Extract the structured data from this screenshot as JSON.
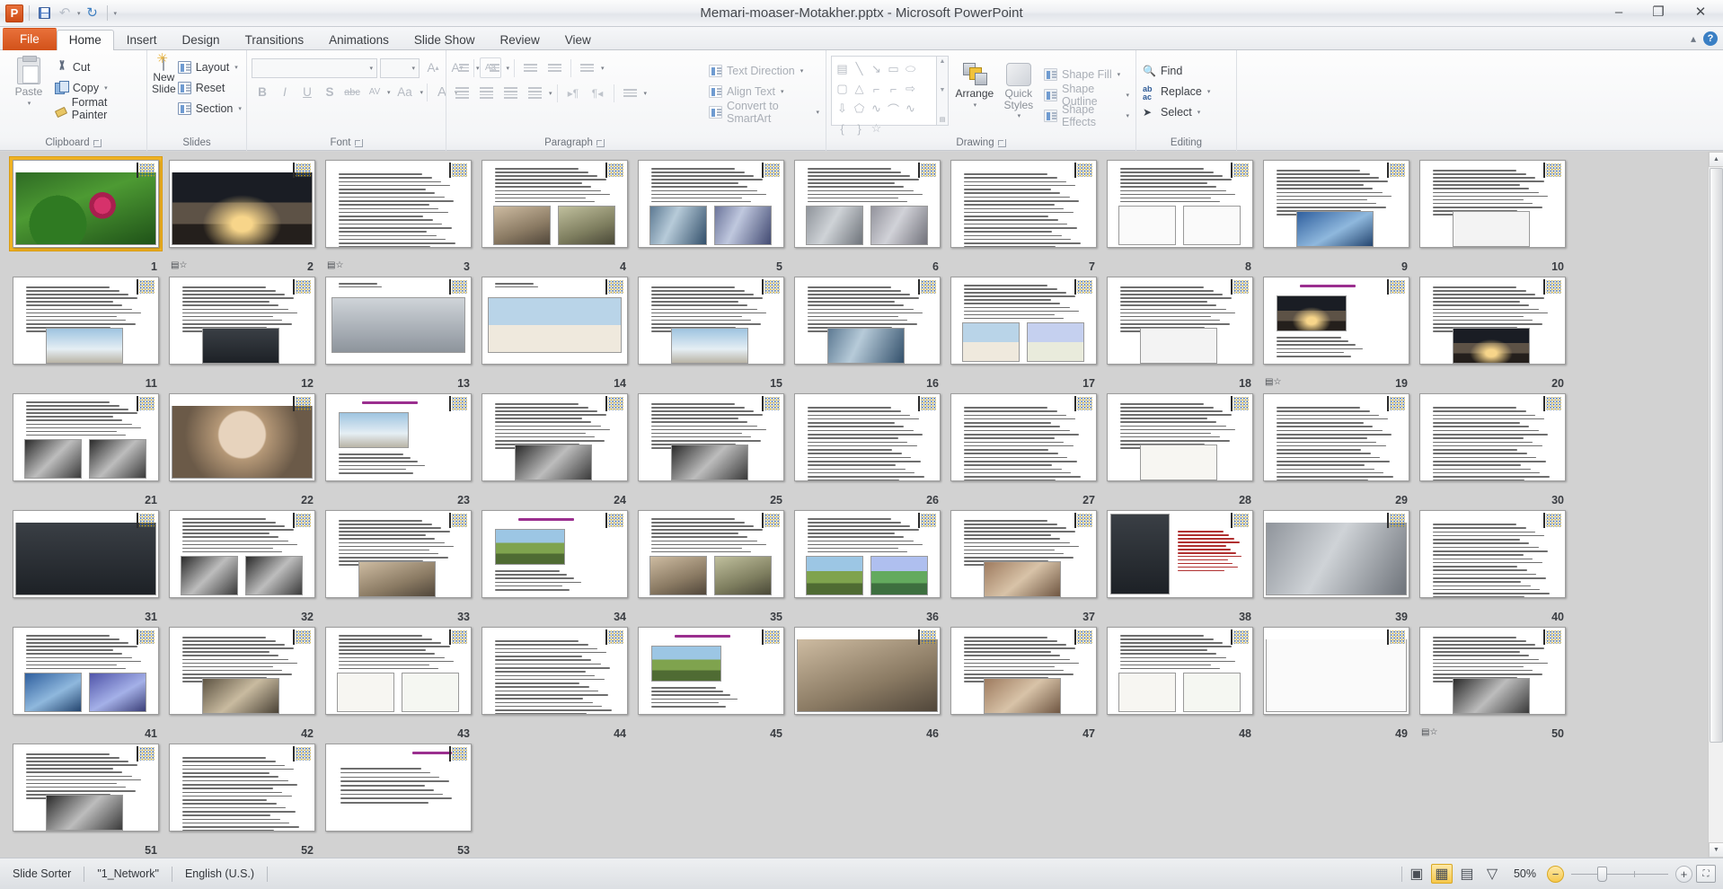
{
  "window": {
    "title": "Memari-moaser-Motakher.pptx  -  Microsoft PowerPoint",
    "minimize": "–",
    "restore": "❐",
    "close": "✕"
  },
  "quick_access": {
    "app_logo": "P",
    "save": "save-icon",
    "undo": "↶",
    "undo_caret": "▾",
    "redo": "↻",
    "customize": "▾"
  },
  "ribbon": {
    "tabs": [
      {
        "label": "File",
        "active": false,
        "file": true
      },
      {
        "label": "Home",
        "active": true
      },
      {
        "label": "Insert",
        "active": false
      },
      {
        "label": "Design",
        "active": false
      },
      {
        "label": "Transitions",
        "active": false
      },
      {
        "label": "Animations",
        "active": false
      },
      {
        "label": "Slide Show",
        "active": false
      },
      {
        "label": "Review",
        "active": false
      },
      {
        "label": "View",
        "active": false
      }
    ],
    "minimize_ribbon": "▴",
    "help": "?",
    "groups": {
      "clipboard": {
        "label": "Clipboard",
        "paste": "Paste",
        "paste_caret": "▾",
        "cut": "Cut",
        "copy": "Copy",
        "copy_caret": "▾",
        "format_painter": "Format Painter"
      },
      "slides": {
        "label": "Slides",
        "new_slide": "New Slide",
        "new_slide_caret": "▾",
        "layout": "Layout",
        "layout_caret": "▾",
        "reset": "Reset",
        "section": "Section",
        "section_caret": "▾"
      },
      "font": {
        "label": "Font",
        "font_name": "",
        "font_size": "",
        "grow_font": "A",
        "shrink_font": "A",
        "clear_formatting": "Aa",
        "bold": "B",
        "italic": "I",
        "underline": "U",
        "shadow": "S",
        "strikethrough": "abc",
        "character_spacing": "AV",
        "change_case": "Aa",
        "font_color": "A"
      },
      "paragraph": {
        "label": "Paragraph",
        "text_direction": "Text Direction",
        "align_text": "Align Text",
        "convert_to_smartart": "Convert to SmartArt"
      },
      "drawing": {
        "label": "Drawing",
        "arrange": "Arrange",
        "quick_styles": "Quick Styles",
        "shape_fill": "Shape Fill",
        "shape_outline": "Shape Outline",
        "shape_effects": "Shape Effects",
        "shapes": [
          "A",
          "╲",
          "↘",
          "▭",
          "⬭",
          "▢",
          "△",
          "⌐",
          "⌐",
          "⇨",
          "⇩",
          "⬠",
          "∿",
          "⌒",
          "∿",
          "{",
          "}",
          "☆"
        ]
      },
      "editing": {
        "label": "Editing",
        "find": "Find",
        "replace": "Replace",
        "replace_caret": "▾",
        "select": "Select",
        "select_caret": "▾"
      }
    }
  },
  "slide_sorter": {
    "selected_slide": 1,
    "slides": [
      {
        "n": 1,
        "layout": "image-full",
        "img": "g-lotus",
        "transition": false
      },
      {
        "n": 2,
        "layout": "image-full",
        "img": "g-opera",
        "transition": true
      },
      {
        "n": 3,
        "layout": "text-only",
        "img": "",
        "transition": true
      },
      {
        "n": 4,
        "layout": "text-two-img",
        "img": "g-int",
        "transition": false
      },
      {
        "n": 5,
        "layout": "text-two-img",
        "img": "g-glass",
        "transition": false
      },
      {
        "n": 6,
        "layout": "text-two-img",
        "img": "g-bldg",
        "transition": false
      },
      {
        "n": 7,
        "layout": "text-only",
        "img": "",
        "transition": false
      },
      {
        "n": 8,
        "layout": "text-two-img",
        "img": "g-plan",
        "transition": false
      },
      {
        "n": 9,
        "layout": "text-one-img",
        "img": "g-blue",
        "transition": false
      },
      {
        "n": 10,
        "layout": "text-one-img",
        "img": "g-white",
        "transition": false
      },
      {
        "n": 11,
        "layout": "text-one-img",
        "img": "g-sky",
        "transition": false
      },
      {
        "n": 12,
        "layout": "text-one-img",
        "img": "g-dark",
        "transition": false
      },
      {
        "n": 13,
        "layout": "image-wide",
        "img": "g-grey",
        "transition": false
      },
      {
        "n": 14,
        "layout": "image-wide",
        "img": "g-curve",
        "transition": false
      },
      {
        "n": 15,
        "layout": "text-one-img",
        "img": "g-sky",
        "transition": false
      },
      {
        "n": 16,
        "layout": "text-one-img",
        "img": "g-glass",
        "transition": false
      },
      {
        "n": 17,
        "layout": "text-two-img",
        "img": "g-curve",
        "transition": false
      },
      {
        "n": 18,
        "layout": "text-one-img",
        "img": "g-white",
        "transition": false
      },
      {
        "n": 19,
        "layout": "title-image",
        "img": "g-opera",
        "transition": true
      },
      {
        "n": 20,
        "layout": "text-one-img",
        "img": "g-opera",
        "transition": false
      },
      {
        "n": 21,
        "layout": "text-two-img",
        "img": "g-bw",
        "transition": false
      },
      {
        "n": 22,
        "layout": "image-full",
        "img": "g-portrait",
        "transition": false
      },
      {
        "n": 23,
        "layout": "title-image",
        "img": "g-sky",
        "transition": false
      },
      {
        "n": 24,
        "layout": "text-one-img",
        "img": "g-bw",
        "transition": false
      },
      {
        "n": 25,
        "layout": "text-one-img",
        "img": "g-bw",
        "transition": false
      },
      {
        "n": 26,
        "layout": "text-only",
        "img": "",
        "transition": false
      },
      {
        "n": 27,
        "layout": "text-only",
        "img": "",
        "transition": false
      },
      {
        "n": 28,
        "layout": "text-one-img",
        "img": "g-sketch",
        "transition": false
      },
      {
        "n": 29,
        "layout": "text-only",
        "img": "",
        "transition": false
      },
      {
        "n": 30,
        "layout": "text-only",
        "img": "",
        "transition": false
      },
      {
        "n": 31,
        "layout": "image-full",
        "img": "g-dark",
        "transition": false
      },
      {
        "n": 32,
        "layout": "text-two-img",
        "img": "g-bw",
        "transition": false
      },
      {
        "n": 33,
        "layout": "text-one-img",
        "img": "g-int",
        "transition": false
      },
      {
        "n": 34,
        "layout": "title-image",
        "img": "g-green",
        "transition": false
      },
      {
        "n": 35,
        "layout": "text-two-img",
        "img": "g-int",
        "transition": false
      },
      {
        "n": 36,
        "layout": "text-two-img",
        "img": "g-green",
        "transition": false
      },
      {
        "n": 37,
        "layout": "text-one-img",
        "img": "g-brick",
        "transition": false
      },
      {
        "n": 38,
        "layout": "image-left-txt",
        "img": "g-dark",
        "transition": false
      },
      {
        "n": 39,
        "layout": "image-full",
        "img": "g-bldg",
        "transition": false
      },
      {
        "n": 40,
        "layout": "text-only",
        "img": "",
        "transition": false
      },
      {
        "n": 41,
        "layout": "text-two-img",
        "img": "g-blue",
        "transition": false
      },
      {
        "n": 42,
        "layout": "text-one-img",
        "img": "g-sepia",
        "transition": false
      },
      {
        "n": 43,
        "layout": "text-two-img",
        "img": "g-sketch",
        "transition": false
      },
      {
        "n": 44,
        "layout": "text-only",
        "img": "",
        "transition": false
      },
      {
        "n": 45,
        "layout": "title-image",
        "img": "g-green",
        "transition": false
      },
      {
        "n": 46,
        "layout": "image-full",
        "img": "g-int",
        "transition": false
      },
      {
        "n": 47,
        "layout": "text-one-img",
        "img": "g-brick",
        "transition": false
      },
      {
        "n": 48,
        "layout": "text-two-img",
        "img": "g-sketch",
        "transition": false
      },
      {
        "n": 49,
        "layout": "image-full",
        "img": "g-plan",
        "transition": false
      },
      {
        "n": 50,
        "layout": "text-one-img",
        "img": "g-bw",
        "transition": true
      },
      {
        "n": 51,
        "layout": "text-one-img",
        "img": "g-bw",
        "transition": false
      },
      {
        "n": 52,
        "layout": "text-only",
        "img": "",
        "transition": false
      },
      {
        "n": 53,
        "layout": "title-text",
        "img": "",
        "transition": false
      }
    ]
  },
  "statusbar": {
    "view_name": "Slide Sorter",
    "theme_name": "\"1_Network\"",
    "language": "English (U.S.)",
    "views": [
      {
        "name": "normal-view",
        "glyph": "▣",
        "active": false
      },
      {
        "name": "slide-sorter-view",
        "glyph": "▦",
        "active": true
      },
      {
        "name": "reading-view",
        "glyph": "▤",
        "active": false
      },
      {
        "name": "slide-show-view",
        "glyph": "▽",
        "active": false
      }
    ],
    "zoom_level": "50%",
    "zoom_out": "−",
    "zoom_in": "+",
    "fit_to_window": "⛶"
  },
  "scrollbar": {
    "up_arrow": "▲",
    "down_arrow": "▼"
  }
}
